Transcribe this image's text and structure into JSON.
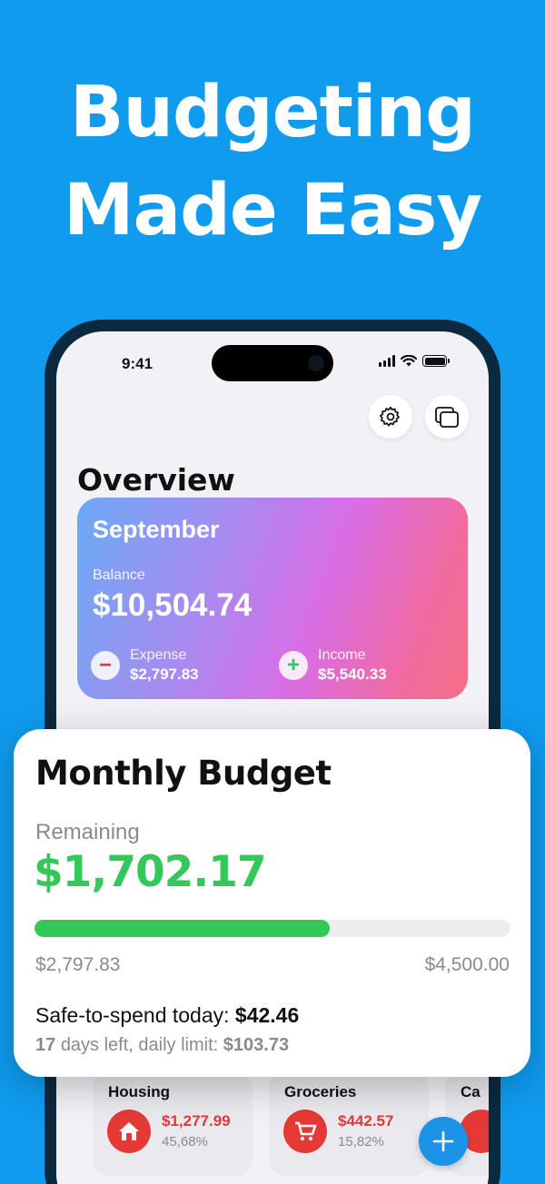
{
  "headline": {
    "line1": "Budgeting",
    "line2": "Made Easy"
  },
  "status_bar": {
    "time": "9:41",
    "icons": [
      "signal-icon",
      "wifi-icon",
      "battery-icon"
    ]
  },
  "toolbar": {
    "icons": [
      "gear-icon",
      "windows-icon"
    ]
  },
  "overview": {
    "title": "Overview",
    "month_card": {
      "month": "September",
      "balance_label": "Balance",
      "balance_value": "$10,504.74",
      "expense_label": "Expense",
      "expense_value": "$2,797.83",
      "income_label": "Income",
      "income_value": "$5,540.33",
      "gradient": [
        "#6aaaf5",
        "#d86ee6",
        "#f56f86"
      ]
    }
  },
  "budget": {
    "title": "Monthly Budget",
    "remaining_label": "Remaining",
    "remaining_value": "$1,702.17",
    "spent": "$2,797.83",
    "limit": "$4,500.00",
    "progress_fraction": 0.62,
    "safe_label": "Safe-to-spend today:",
    "safe_value": "$42.46",
    "days_left": "17",
    "days_text": "days left, daily limit:",
    "daily_limit": "$103.73"
  },
  "categories": [
    {
      "name": "Housing",
      "amount": "$1,277.99",
      "percent": "45,68%",
      "icon": "house-icon"
    },
    {
      "name": "Groceries",
      "amount": "$442.57",
      "percent": "15,82%",
      "icon": "cart-icon"
    },
    {
      "name": "Ca",
      "amount": "",
      "percent": "",
      "icon": ""
    }
  ],
  "colors": {
    "background": "#0f9bee",
    "positive": "#34c759",
    "negative": "#e53935",
    "fab": "#1b94e8"
  },
  "fab": {
    "icon": "plus-icon"
  }
}
